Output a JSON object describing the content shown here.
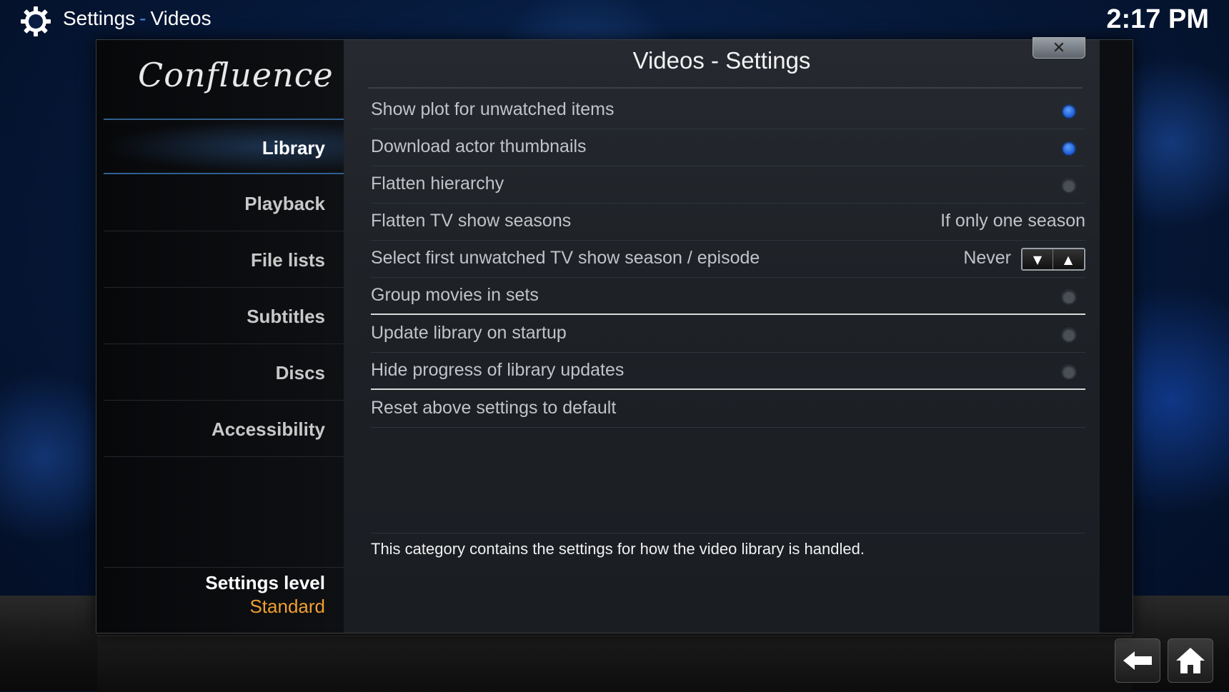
{
  "header": {
    "section": "Settings",
    "separator": "-",
    "subsection": "Videos",
    "clock": "2:17 PM"
  },
  "dialog": {
    "title": "Videos - Settings",
    "close_label": "✕",
    "logo": "Confluence"
  },
  "sidebar": {
    "items": [
      {
        "label": "Library",
        "active": true
      },
      {
        "label": "Playback",
        "active": false
      },
      {
        "label": "File lists",
        "active": false
      },
      {
        "label": "Subtitles",
        "active": false
      },
      {
        "label": "Discs",
        "active": false
      },
      {
        "label": "Accessibility",
        "active": false
      }
    ],
    "settings_level_label": "Settings level",
    "settings_level_value": "Standard"
  },
  "settings": [
    {
      "label": "Show plot for unwatched items",
      "type": "toggle",
      "on": true
    },
    {
      "label": "Download actor thumbnails",
      "type": "toggle",
      "on": true
    },
    {
      "label": "Flatten hierarchy",
      "type": "toggle",
      "on": false
    },
    {
      "label": "Flatten TV show seasons",
      "type": "value",
      "value": "If only one season"
    },
    {
      "label": "Select first unwatched TV show season / episode",
      "type": "spinner",
      "value": "Never"
    },
    {
      "label": "Group movies in sets",
      "type": "toggle",
      "on": false
    },
    {
      "label": "Update library on startup",
      "type": "toggle",
      "on": false
    },
    {
      "label": "Hide progress of library updates",
      "type": "toggle",
      "on": false
    },
    {
      "label": "Reset above settings to default",
      "type": "action"
    }
  ],
  "description": "This category contains the settings for how the video library is handled.",
  "colors": {
    "accent_blue": "#1b56d0",
    "level_orange": "#f0a030"
  },
  "icons": {
    "header": "gear-icon",
    "back": "back-arrow-icon",
    "home": "home-icon"
  }
}
